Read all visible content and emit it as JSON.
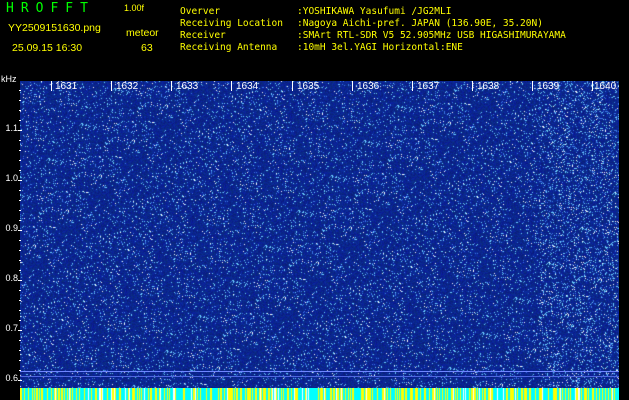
{
  "header": {
    "app_title": "HROFFT",
    "version": "1.00f",
    "filename": "YY2509151630.png",
    "datetime": "25.09.15 16:30",
    "event_label": "meteor",
    "event_count": "63"
  },
  "station_info": [
    {
      "key": "Overver",
      "value": ":YOSHIKAWA Yasufumi /JG2MLI"
    },
    {
      "key": "Receiving Location",
      "value": ":Nagoya Aichi-pref. JAPAN (136.90E, 35.20N)"
    },
    {
      "key": "Receiver",
      "value": ":SMArt RTL-SDR V5 52.905MHz USB HIGASHIMURAYAMA"
    },
    {
      "key": "Receiving Antenna",
      "value": ":10mH 3el.YAGI Horizontal:ENE"
    }
  ],
  "spectrogram": {
    "y_unit": "kHz",
    "y_ticks": [
      "1.1",
      "1.0",
      "0.9",
      "0.8",
      "0.7",
      "0.6"
    ],
    "x_ticks": [
      "1631",
      "1632",
      "1633",
      "1634",
      "1635",
      "1636",
      "1637",
      "1638",
      "1639",
      "1640"
    ],
    "colors": {
      "background": "#0a1f8a",
      "text": "#ffff00",
      "title": "#00ff00",
      "noise_light": "#6fd0ff",
      "noise_white": "#ffffff"
    }
  }
}
